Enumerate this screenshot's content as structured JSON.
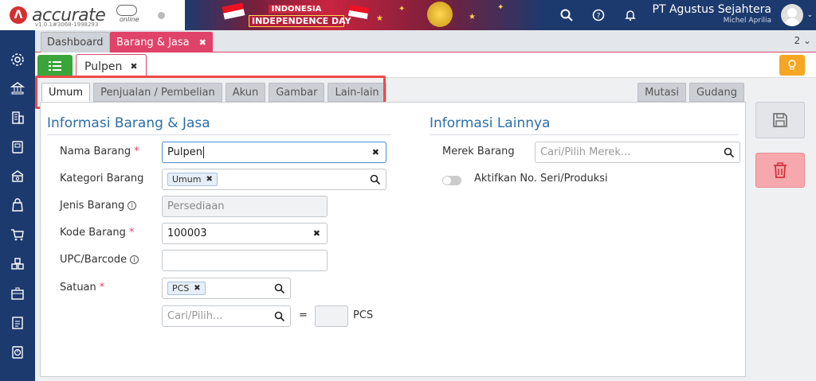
{
  "brand": {
    "logo_letter": "Λ",
    "name": "accurate",
    "suffix": "online",
    "version": "v1.0.1#3068-1998293"
  },
  "banner": {
    "line1": "INDONESIA",
    "line2": "INDEPENDENCE DAY"
  },
  "header": {
    "company": "PT Agustus Sejahtera",
    "user": "Michel Aprilia",
    "icons": [
      "search-icon",
      "help-icon",
      "bell-icon"
    ]
  },
  "sidebar": {
    "icons": [
      "gear-icon",
      "bank-icon",
      "building-icon",
      "book-icon",
      "money-icon",
      "bag-icon",
      "cart-icon",
      "inventory-icon",
      "asset-icon",
      "tax-icon",
      "report-icon"
    ]
  },
  "tabs": {
    "dashboard": "Dashboard",
    "active": "Barang & Jasa",
    "active_close": "✖",
    "count": "2"
  },
  "doc": {
    "tab_label": "Pulpen",
    "close": "✖"
  },
  "subtabs": {
    "items": [
      "Umum",
      "Penjualan / Pembelian",
      "Akun",
      "Gambar",
      "Lain-lain"
    ],
    "right": [
      "Mutasi",
      "Gudang"
    ]
  },
  "form": {
    "section_left": "Informasi Barang & Jasa",
    "section_right": "Informasi Lainnya",
    "nama_label": "Nama Barang",
    "nama_value": "Pulpen",
    "kategori_label": "Kategori Barang",
    "kategori_chip": "Umum",
    "jenis_label": "Jenis Barang",
    "jenis_value": "Persediaan",
    "kode_label": "Kode Barang",
    "kode_value": "100003",
    "upc_label": "UPC/Barcode",
    "upc_value": "",
    "satuan_label": "Satuan",
    "satuan_chip": "PCS",
    "konversi_placeholder": "Cari/Pilih...",
    "equals": "=",
    "konversi_unit": "PCS",
    "merek_label": "Merek Barang",
    "merek_placeholder": "Cari/Pilih Merek...",
    "seri_label": "Aktifkan No. Seri/Produksi",
    "required_mark": "*",
    "info_mark": "i"
  },
  "colors": {
    "navy": "#1d3a6e",
    "accent_pink": "#e0436a",
    "title_blue": "#2c6ea8",
    "highlight_red": "#ef4a4a",
    "green": "#3aa53a",
    "orange": "#f5a623"
  }
}
